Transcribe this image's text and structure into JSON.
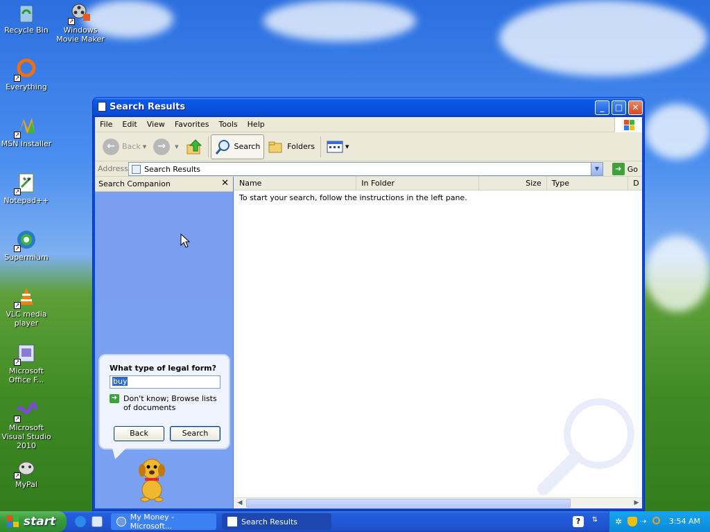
{
  "desktop": {
    "icons": [
      {
        "label": "Recycle Bin",
        "icon": "recycle-bin-icon"
      },
      {
        "label": "Windows Movie Maker",
        "icon": "movie-maker-icon"
      },
      {
        "label": "Everything",
        "icon": "everything-icon"
      },
      {
        "label": "MSN Installer",
        "icon": "msn-icon"
      },
      {
        "label": "Notepad++",
        "icon": "notepad-plus-plus-icon"
      },
      {
        "label": "Supermium",
        "icon": "supermium-icon"
      },
      {
        "label": "VLC media player",
        "icon": "vlc-icon"
      },
      {
        "label": "Microsoft Office F...",
        "icon": "office-icon"
      },
      {
        "label": "Microsoft Visual Studio 2010",
        "icon": "visual-studio-icon"
      },
      {
        "label": "MyPal",
        "icon": "mypal-icon"
      }
    ]
  },
  "window": {
    "title": "Search Results",
    "menu": [
      "File",
      "Edit",
      "View",
      "Favorites",
      "Tools",
      "Help"
    ],
    "toolbar": {
      "back": "Back",
      "search": "Search",
      "folders": "Folders"
    },
    "address": {
      "label": "Address",
      "value": "Search Results",
      "go": "Go"
    },
    "search_companion": {
      "header": "Search Companion",
      "question": "What type of legal form?",
      "input_value": "buy",
      "browse_link": "Don't know; Browse lists of documents",
      "back_button": "Back",
      "search_button": "Search"
    },
    "results": {
      "columns": [
        "Name",
        "In Folder",
        "Size",
        "Type",
        "D"
      ],
      "empty_message": "To start your search, follow the instructions in the left pane."
    }
  },
  "taskbar": {
    "start_label": "start",
    "tasks": [
      {
        "label": "My Money - Microsoft...",
        "active": false
      },
      {
        "label": "Search Results",
        "active": true
      }
    ],
    "clock": "3:54 AM"
  },
  "colors": {
    "titlebar": "#0a52e0",
    "taskbar": "#2258d8",
    "start_green": "#3a9a3a",
    "tray": "#0b8bd9",
    "search_pane": "#7aa0f2"
  }
}
